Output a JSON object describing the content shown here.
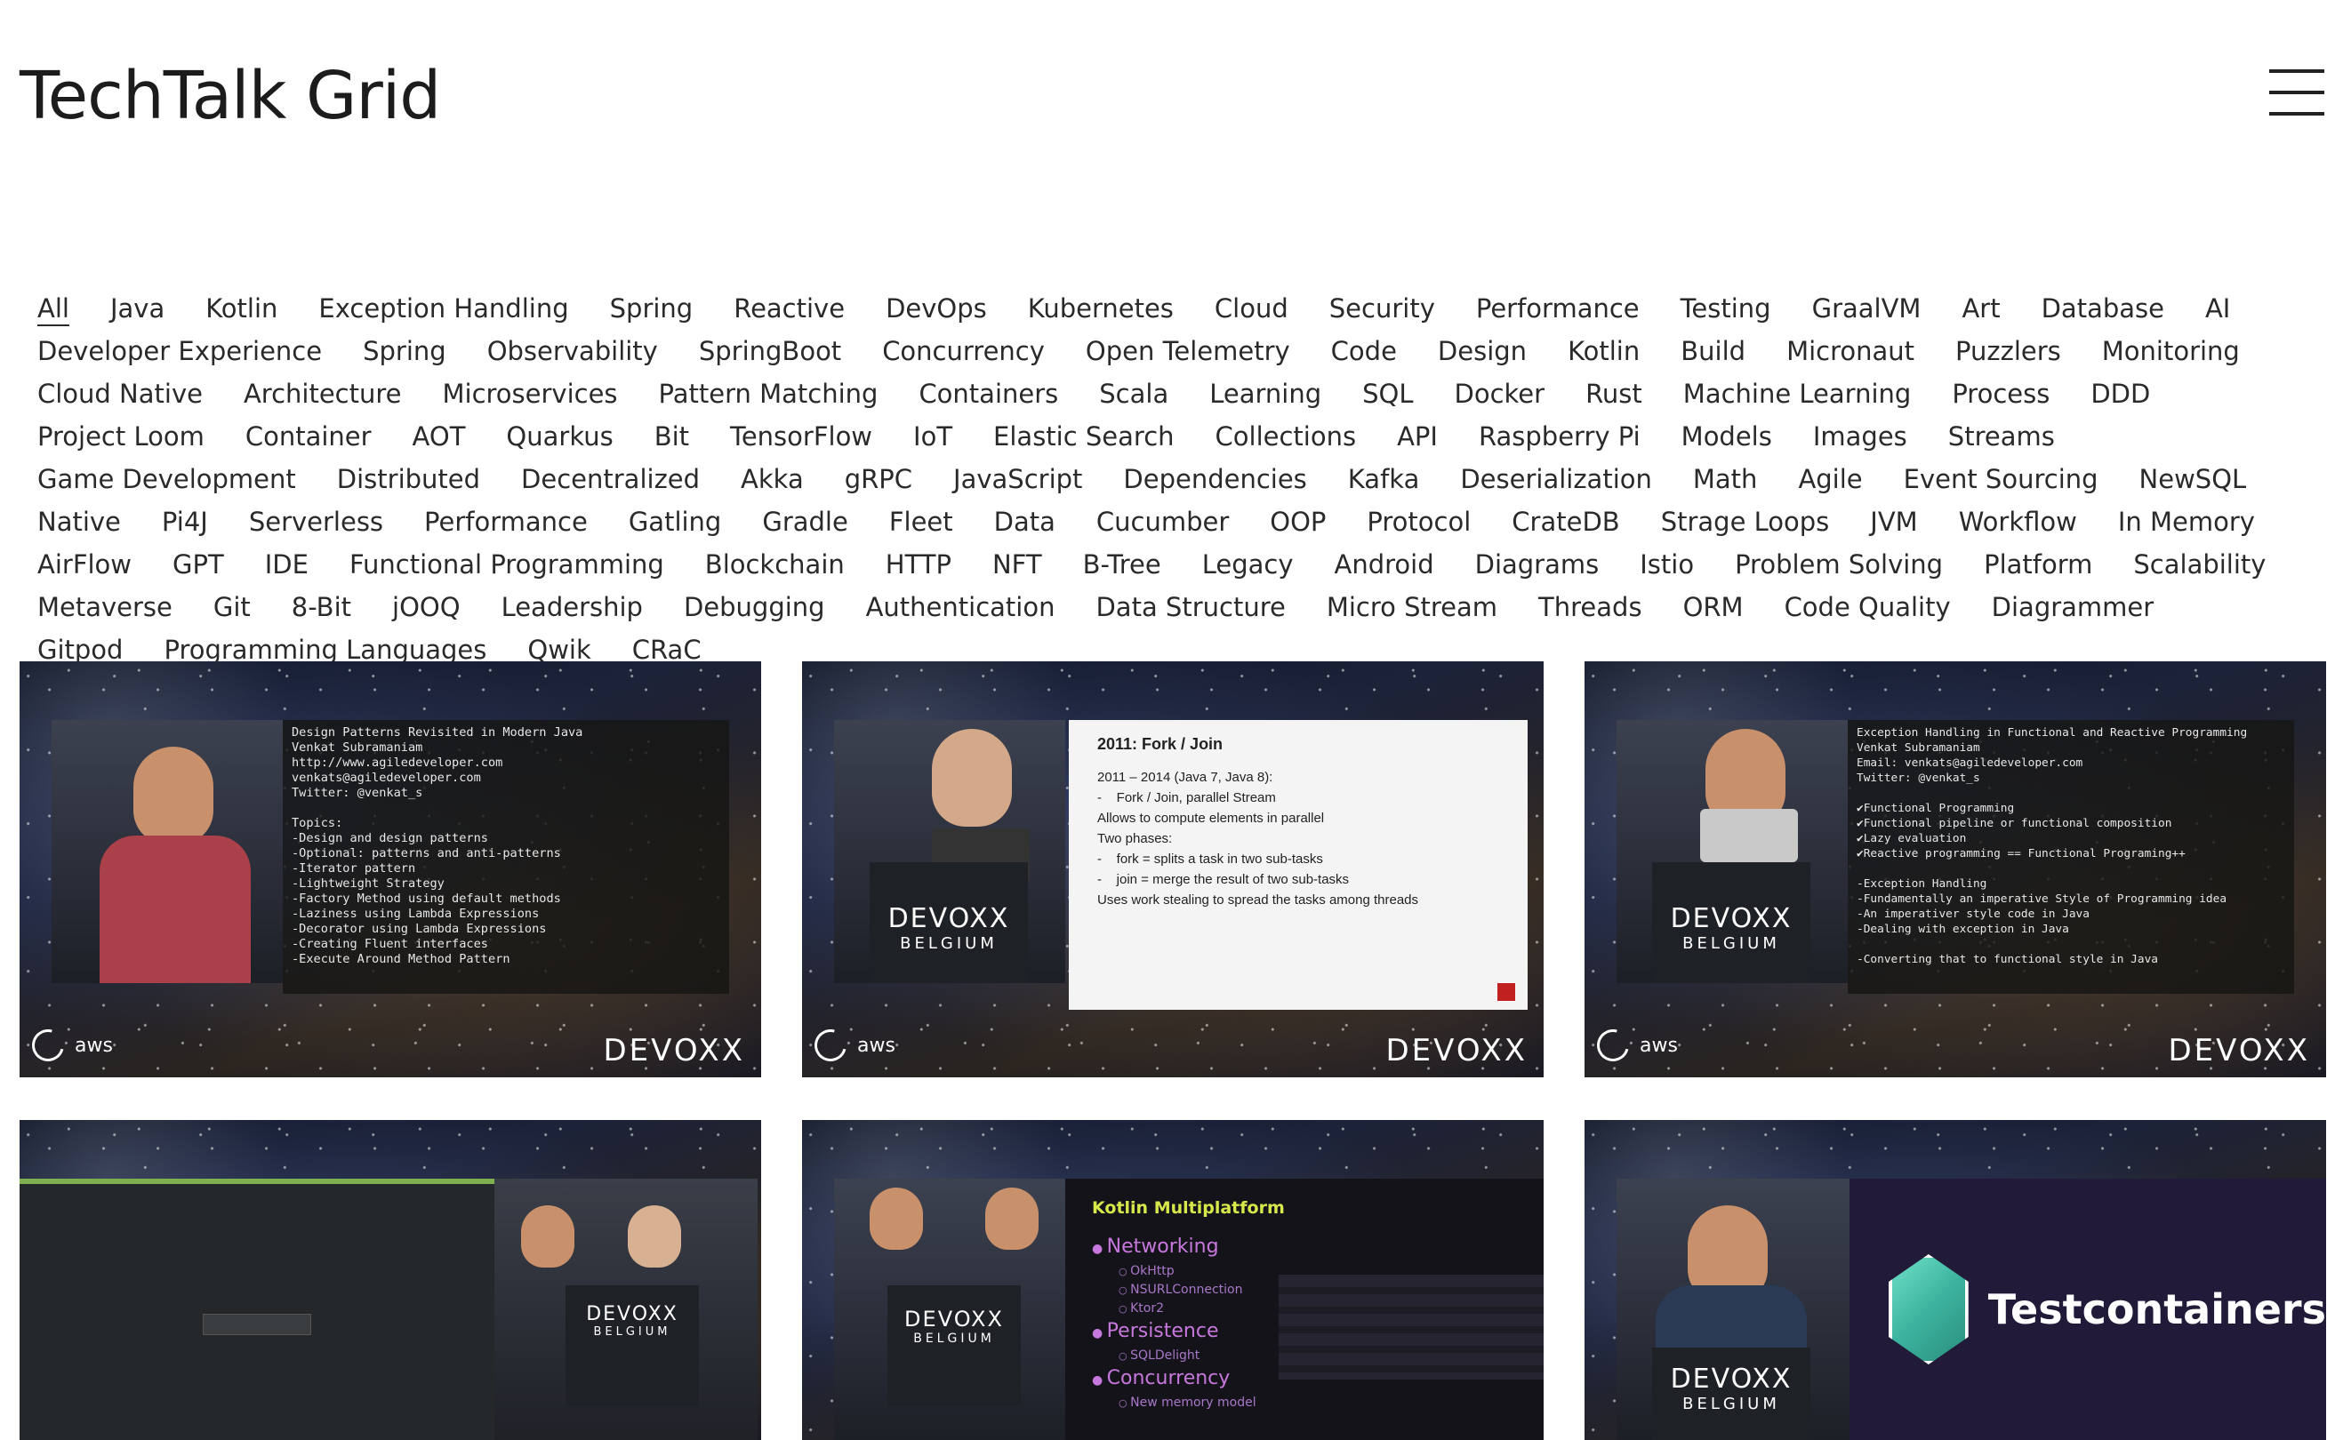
{
  "header": {
    "title": "TechTalk Grid",
    "menu_icon": "hamburger-menu-icon"
  },
  "tags": [
    "All",
    "Java",
    "Kotlin",
    "Exception Handling",
    "Spring",
    "Reactive",
    "DevOps",
    "Kubernetes",
    "Cloud",
    "Security",
    "Performance",
    "Testing",
    "GraalVM",
    "Art",
    "Database",
    "AI",
    "Developer Experience",
    "Spring",
    "Observability",
    "SpringBoot",
    "Concurrency",
    "Open Telemetry",
    "Code",
    "Design",
    "Kotlin",
    "Build",
    "Micronaut",
    "Puzzlers",
    "Monitoring",
    "Cloud Native",
    "Architecture",
    "Microservices",
    "Pattern Matching",
    "Containers",
    "Scala",
    "Learning",
    "SQL",
    "Docker",
    "Rust",
    "Machine Learning",
    "Process",
    "DDD",
    "Project Loom",
    "Container",
    "AOT",
    "Quarkus",
    "Bit",
    "TensorFlow",
    "IoT",
    "Elastic Search",
    "Collections",
    "API",
    "Raspberry Pi",
    "Models",
    "Images",
    "Streams",
    "Game Development",
    "Distributed",
    "Decentralized",
    "Akka",
    "gRPC",
    "JavaScript",
    "Dependencies",
    "Kafka",
    "Deserialization",
    "Math",
    "Agile",
    "Event Sourcing",
    "NewSQL",
    "Native",
    "Pi4J",
    "Serverless",
    "Performance",
    "Gatling",
    "Gradle",
    "Fleet",
    "Data",
    "Cucumber",
    "OOP",
    "Protocol",
    "CrateDB",
    "Strage Loops",
    "JVM",
    "Workflow",
    "In Memory",
    "AirFlow",
    "GPT",
    "IDE",
    "Functional Programming",
    "Blockchain",
    "HTTP",
    "NFT",
    "B-Tree",
    "Legacy",
    "Android",
    "Diagrams",
    "Istio",
    "Problem Solving",
    "Platform",
    "Scalability",
    "Metaverse",
    "Git",
    "8-Bit",
    "jOOQ",
    "Leadership",
    "Debugging",
    "Authentication",
    "Data Structure",
    "Micro Stream",
    "Threads",
    "ORM",
    "Code Quality",
    "Diagrammer",
    "Gitpod",
    "Programming Languages",
    "Qwik",
    "CRaC"
  ],
  "active_tag": "All",
  "videos": [
    {
      "slide_type": "terminal",
      "slide_text": "Design Patterns Revisited in Modern Java\nVenkat Subramaniam\nhttp://www.agiledeveloper.com\nvenkats@agiledeveloper.com\nTwitter: @venkat_s\n\nTopics:\n-Design and design patterns\n-Optional: patterns and anti-patterns\n-Iterator pattern\n-Lightweight Strategy\n-Factory Method using default methods\n-Laziness using Lambda Expressions\n-Decorator using Lambda Expressions\n-Creating Fluent interfaces\n-Execute Around Method Pattern",
      "aws_label": "aws",
      "devoxx_label": "DEVOXX"
    },
    {
      "slide_type": "light",
      "slide_heading": "2011: Fork / Join",
      "slide_lines": [
        "2011 – 2014 (Java 7, Java 8):",
        "-    Fork / Join, parallel Stream",
        "",
        "Allows to compute elements in parallel",
        "Two phases:",
        "-    fork = splits a task in two sub-tasks",
        "-    join = merge the result of two sub-tasks",
        "Uses work stealing to spread the tasks among threads"
      ],
      "podium_brand": "DEVOXX",
      "podium_sub": "BELGIUM",
      "aws_label": "aws",
      "devoxx_label": "DEVOXX"
    },
    {
      "slide_type": "terminal",
      "slide_text": "Exception Handling in Functional and Reactive Programming\nVenkat Subramaniam\nEmail: venkats@agiledeveloper.com\nTwitter: @venkat_s\n\n✔Functional Programming\n✔Functional pipeline or functional composition\n✔Lazy evaluation\n✔Reactive programming == Functional Programing++\n\n-Exception Handling\n-Fundamentally an imperative Style of Programming idea\n-An imperativer style code in Java\n-Dealing with exception in Java\n\n-Converting that to functional style in Java",
      "podium_brand": "DEVOXX",
      "podium_sub": "BELGIUM",
      "aws_label": "aws",
      "devoxx_label": "DEVOXX"
    },
    {
      "slide_type": "screen",
      "podium_brand": "DEVOXX",
      "podium_sub": "BELGIUM"
    },
    {
      "slide_type": "kotlin",
      "slide_heading": "Kotlin Multiplatform",
      "podium_brand": "DEVOXX",
      "podium_sub": "BELGIUM",
      "sections": [
        {
          "item": "Networking",
          "subs": [
            "OkHttp",
            "NSURLConnection",
            "Ktor2"
          ]
        },
        {
          "item": "Persistence",
          "subs": [
            "SQLDelight"
          ]
        },
        {
          "item": "Concurrency",
          "subs": [
            "New memory model"
          ]
        }
      ]
    },
    {
      "slide_type": "testcontainers",
      "brand_label": "Testcontainers",
      "podium_brand": "DEVOXX",
      "podium_sub": "BELGIUM"
    }
  ]
}
